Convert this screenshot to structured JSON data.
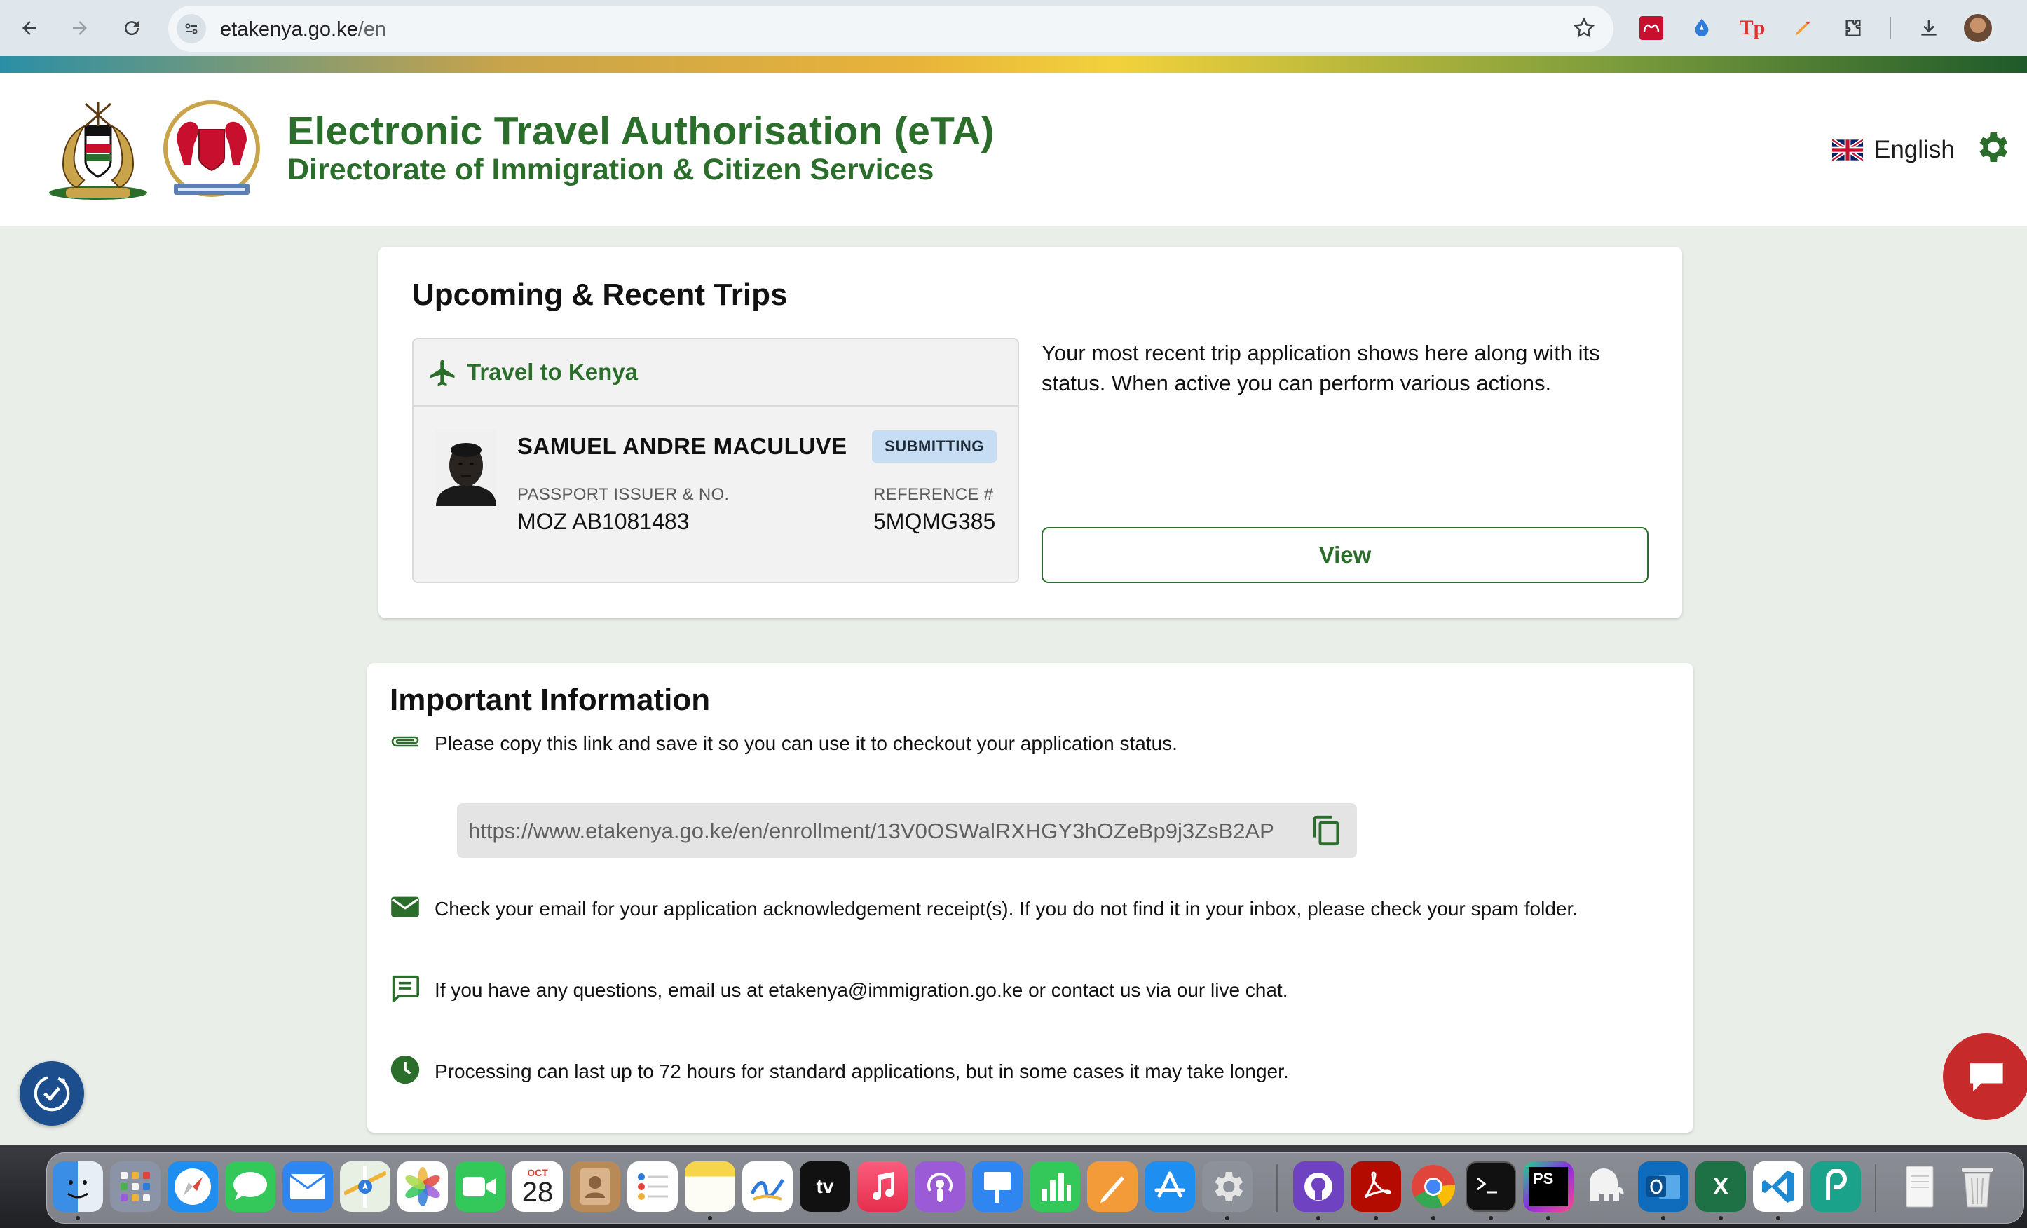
{
  "browser": {
    "url_host": "etakenya.go.ke",
    "url_path": "/en",
    "nav": [
      "back-icon",
      "forward-icon",
      "reload-icon"
    ],
    "extensions": [
      "mendeley-icon",
      "drop-icon",
      "tp-icon",
      "pen-icon",
      "puzzle-icon",
      "download-icon"
    ]
  },
  "header": {
    "title": "Electronic Travel Authorisation (eTA)",
    "subtitle": "Directorate of Immigration & Citizen Services",
    "language": "English"
  },
  "trips": {
    "heading": "Upcoming & Recent Trips",
    "trip_title": "Travel to Kenya",
    "traveler_name": "SAMUEL ANDRE MACULUVE",
    "status": "SUBMITTING",
    "passport_label": "PASSPORT ISSUER & NO.",
    "passport_value": "MOZ AB1081483",
    "reference_label": "REFERENCE #",
    "reference_value": "5MQMG385",
    "description": "Your most recent trip application shows here along with its status. When active you can perform various actions.",
    "view_label": "View"
  },
  "info": {
    "heading": "Important Information",
    "copy_text": "Please copy this link and save it so you can use it to checkout your application status.",
    "link": "https://www.etakenya.go.ke/en/enrollment/13V0OSWalRXHGY3hOZeBp9j3ZsB2AP",
    "email_text": "Check your email for your application acknowledgement receipt(s). If you do not find it in your inbox, please check your spam folder.",
    "contact_text": "If you have any questions, email us at etakenya@immigration.go.ke or contact us via our live chat.",
    "processing_text": "Processing can last up to 72 hours for standard applications, but in some cases it may take longer."
  },
  "dock": {
    "calendar_month": "OCT",
    "calendar_day": "28",
    "tv_label": "tv",
    "ps_label": "PS",
    "excel_label": "X"
  },
  "colors": {
    "brand_green": "#2b6d2a",
    "badge_blue": "#c7ddf3",
    "chat_red": "#c62a2a"
  }
}
